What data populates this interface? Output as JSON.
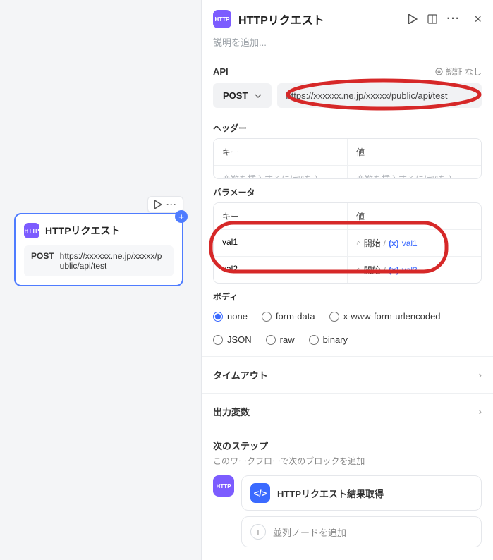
{
  "canvas": {
    "node": {
      "title": "HTTPリクエスト",
      "method": "POST",
      "url": "https://xxxxxx.ne.jp/xxxxx/public/api/test"
    }
  },
  "panel": {
    "title": "HTTPリクエスト",
    "description_placeholder": "説明を追加...",
    "api": {
      "label": "API",
      "auth_label": "認証 なし",
      "method": "POST",
      "url": "https://xxxxxx.ne.jp/xxxxx/public/api/test"
    },
    "headers": {
      "label": "ヘッダー",
      "key_header": "キー",
      "value_header": "値",
      "key_placeholder": "変数を挿入するには'/'を入...",
      "value_placeholder": "変数を挿入するには'/'を入..."
    },
    "params": {
      "label": "パラメータ",
      "key_header": "キー",
      "value_header": "値",
      "rows": [
        {
          "key": "val1",
          "start": "開始",
          "var": "val1"
        },
        {
          "key": "val2",
          "start": "開始",
          "var": "val2"
        }
      ]
    },
    "body": {
      "label": "ボディ",
      "options": [
        "none",
        "form-data",
        "x-www-form-urlencoded",
        "JSON",
        "raw",
        "binary"
      ],
      "selected": "none"
    },
    "timeout_label": "タイムアウト",
    "output_label": "出力変数",
    "next": {
      "title": "次のステップ",
      "subtitle": "このワークフローで次のブロックを追加",
      "card1_label": "HTTPリクエスト結果取得",
      "card2_label": "並列ノードを追加"
    }
  }
}
